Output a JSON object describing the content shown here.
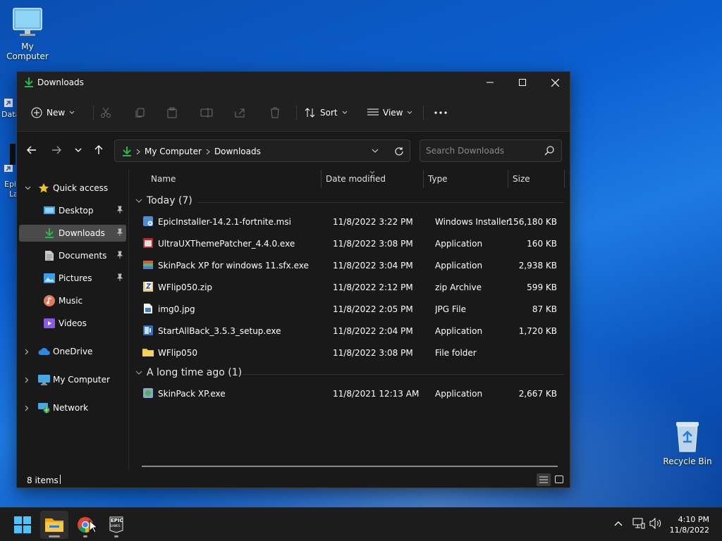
{
  "desktop": {
    "icons": [
      {
        "label": "My Computer"
      },
      {
        "label": "Recycle Bin"
      }
    ],
    "partial_labels": [
      "Data",
      "Epi",
      "La"
    ]
  },
  "window": {
    "title": "Downloads",
    "toolbar": {
      "new_label": "New",
      "sort_label": "Sort",
      "view_label": "View"
    },
    "address": {
      "crumbs": [
        "My Computer",
        "Downloads"
      ]
    },
    "search": {
      "placeholder": "Search Downloads"
    },
    "sidebar": {
      "items": [
        {
          "label": "Quick access",
          "icon": "star-icon"
        },
        {
          "label": "Desktop",
          "icon": "desktop-folder-icon",
          "pinned": true
        },
        {
          "label": "Downloads",
          "icon": "download-icon",
          "pinned": true,
          "active": true
        },
        {
          "label": "Documents",
          "icon": "document-icon",
          "pinned": true
        },
        {
          "label": "Pictures",
          "icon": "pictures-icon",
          "pinned": true
        },
        {
          "label": "Music",
          "icon": "music-icon"
        },
        {
          "label": "Videos",
          "icon": "videos-icon"
        },
        {
          "label": "OneDrive",
          "icon": "cloud-icon"
        },
        {
          "label": "My Computer",
          "icon": "computer-icon"
        },
        {
          "label": "Network",
          "icon": "network-icon"
        }
      ]
    },
    "columns": {
      "name": "Name",
      "date": "Date modified",
      "type": "Type",
      "size": "Size"
    },
    "groups": [
      {
        "label": "Today (7)",
        "files": [
          {
            "name": "EpicInstaller-14.2.1-fortnite.msi",
            "date": "11/8/2022 3:22 PM",
            "type": "Windows Installer ...",
            "size": "156,180 KB",
            "icon": "msi-icon"
          },
          {
            "name": "UltraUXThemePatcher_4.4.0.exe",
            "date": "11/8/2022 3:08 PM",
            "type": "Application",
            "size": "160 KB",
            "icon": "exe-icon"
          },
          {
            "name": "SkinPack XP for windows 11.sfx.exe",
            "date": "11/8/2022 3:04 PM",
            "type": "Application",
            "size": "2,938 KB",
            "icon": "archive-exe-icon"
          },
          {
            "name": "WFlip050.zip",
            "date": "11/8/2022 2:12 PM",
            "type": "zip Archive",
            "size": "599 KB",
            "icon": "zip-icon"
          },
          {
            "name": "img0.jpg",
            "date": "11/8/2022 2:05 PM",
            "type": "JPG File",
            "size": "87 KB",
            "icon": "image-file-icon"
          },
          {
            "name": "StartAllBack_3.5.3_setup.exe",
            "date": "11/8/2022 2:04 PM",
            "type": "Application",
            "size": "1,720 KB",
            "icon": "setup-icon"
          },
          {
            "name": "WFlip050",
            "date": "11/8/2022 3:08 PM",
            "type": "File folder",
            "size": "",
            "icon": "folder-icon"
          }
        ]
      },
      {
        "label": "A long time ago (1)",
        "files": [
          {
            "name": "SkinPack XP.exe",
            "date": "11/8/2021 12:13 AM",
            "type": "Application",
            "size": "2,667 KB",
            "icon": "exe-icon"
          }
        ]
      }
    ],
    "status": {
      "item_count": "8 items"
    }
  },
  "taskbar": {
    "time": "4:10 PM",
    "date": "11/8/2022",
    "epic_label_top": "EPIC",
    "epic_label_bottom": "GAMES"
  },
  "colors": {
    "window_bg": "#191919",
    "chrome_bg": "#202020",
    "accent_green": "#2fb34a",
    "folder_yellow": "#f2c33a"
  }
}
